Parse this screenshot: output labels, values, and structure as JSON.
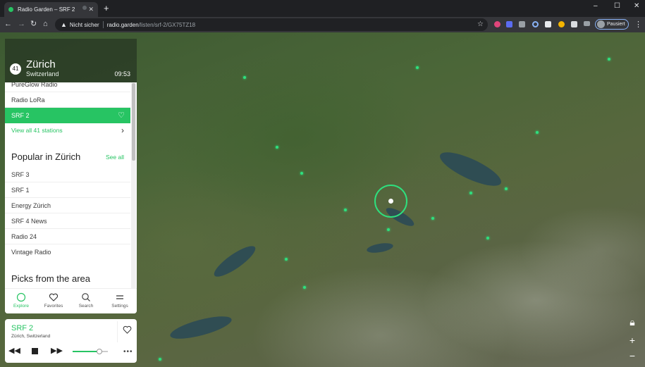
{
  "browser": {
    "tab_title": "Radio Garden – SRF 2",
    "tab_close": "✕",
    "new_tab": "+",
    "not_secure": "Nicht sicher",
    "url_host": "radio.garden",
    "url_path": "/listen/srf-2/GX75TZ18",
    "profile_label": "Pausiert",
    "window_controls": [
      "–",
      "☐",
      "✕"
    ]
  },
  "location": {
    "station_count": "41",
    "city": "Zürich",
    "country": "Switzerland",
    "local_time": "09:53"
  },
  "stations": [
    {
      "label": "PureGlow Radio",
      "active": false
    },
    {
      "label": "Radio LoRa",
      "active": false
    },
    {
      "label": "SRF 2",
      "active": true
    }
  ],
  "view_all_label": "View all 41 stations",
  "popular": {
    "title": "Popular in Zürich",
    "see_all": "See all",
    "items": [
      "SRF 3",
      "SRF 1",
      "Energy Zürich",
      "SRF 4 News",
      "Radio 24",
      "Vintage Radio"
    ]
  },
  "picks_title": "Picks from the area",
  "nav_tabs": [
    {
      "label": "Explore",
      "icon": "explore-icon",
      "active": true
    },
    {
      "label": "Favorites",
      "icon": "heart-icon",
      "active": false
    },
    {
      "label": "Search",
      "icon": "search-icon",
      "active": false
    },
    {
      "label": "Settings",
      "icon": "settings-icon",
      "active": false
    }
  ],
  "player": {
    "station": "SRF 2",
    "location": "Zürich, Switzerland",
    "volume_fraction": 0.75
  },
  "map_controls": [
    "lock-icon",
    "zoom-in-icon",
    "zoom-out-icon"
  ],
  "colors": {
    "accent": "#27c463",
    "station_dot": "#2ee07e"
  }
}
